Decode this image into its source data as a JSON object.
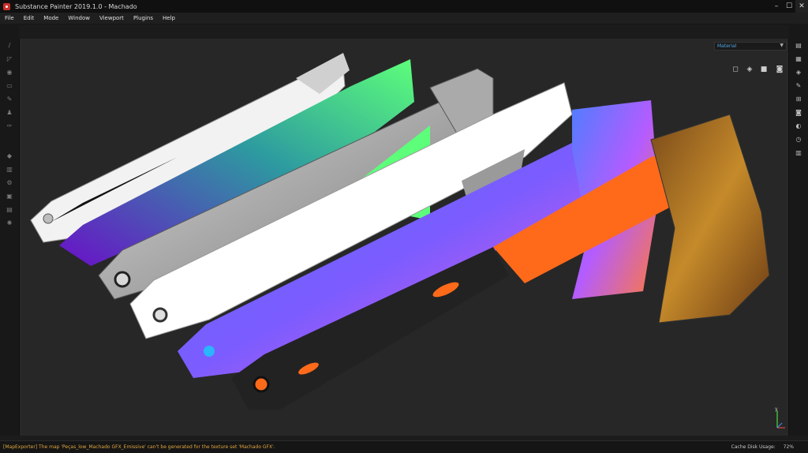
{
  "window": {
    "title": "Substance Painter 2019.1.0 - Machado",
    "controls": [
      "minimize-icon",
      "maximize-icon",
      "close-icon"
    ]
  },
  "menu": {
    "items": [
      "File",
      "Edit",
      "Mode",
      "Window",
      "Viewport",
      "Plugins",
      "Help"
    ]
  },
  "viewport": {
    "channel_dropdown": "Material",
    "models": [
      {
        "name": "ambient-occlusion-axe",
        "colors": [
          "#f2f2f2",
          "#9a9a9a",
          "#111111"
        ]
      },
      {
        "name": "uv-gradient-axe",
        "colors": [
          "#5dff7a",
          "#2d9aa0",
          "#6a10c8"
        ]
      },
      {
        "name": "height-axe",
        "colors": [
          "#c8c8c8",
          "#8a8a8a",
          "#5a5a5a"
        ]
      },
      {
        "name": "white-axe",
        "colors": [
          "#ffffff",
          "#e6e6e6",
          "#9a9a9a"
        ]
      },
      {
        "name": "normal-map-axe",
        "colors": [
          "#7b5cff",
          "#5c6bff",
          "#ff5cd8"
        ]
      },
      {
        "name": "final-material-axe",
        "colors": [
          "#ff6a1a",
          "#222222",
          "#b5781e"
        ]
      }
    ]
  },
  "status": {
    "message": "[MapExporter] The map 'Peças_low_Machado GFX_Emissive' can't be generated for the texture set 'Machado GFX'.",
    "cache_label": "Cache Disk Usage:",
    "cache_value": "72%"
  }
}
